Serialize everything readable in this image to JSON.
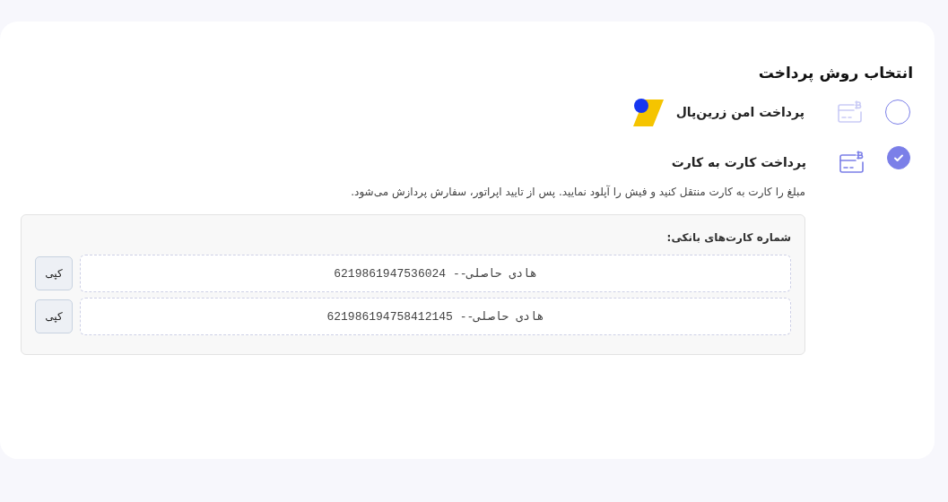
{
  "title": "انتخاب روش پرداخت",
  "methods": [
    {
      "label": "پرداخت امن زرین‌پال",
      "selected": false,
      "kind": "gateway"
    },
    {
      "label": "پرداخت کارت به کارت",
      "selected": true,
      "kind": "card"
    }
  ],
  "instructions": "مبلغ را کارت به کارت منتقل کنید و فیش را آپلود نمایید. پس از تایید اپراتور، سفارش پردازش می‌شود.",
  "bank_cards": {
    "heading": "شماره کارت‌های بانکی:",
    "items": [
      {
        "text": "هادی حاصلی-- 6219861947536024",
        "button": "کپی"
      },
      {
        "text": "هادی حاصلی-- 621986194758412145",
        "button": "کپی"
      }
    ]
  }
}
